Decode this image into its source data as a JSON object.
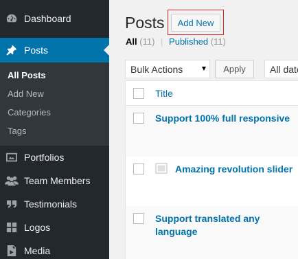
{
  "sidebar": {
    "items": [
      {
        "label": "Dashboard",
        "icon": "dashboard-icon"
      },
      {
        "label": "Posts",
        "icon": "pin-icon",
        "active": true
      },
      {
        "label": "Portfolios",
        "icon": "image-icon"
      },
      {
        "label": "Team Members",
        "icon": "people-icon"
      },
      {
        "label": "Testimonials",
        "icon": "quote-icon"
      },
      {
        "label": "Logos",
        "icon": "grid-icon"
      },
      {
        "label": "Media",
        "icon": "media-icon"
      }
    ],
    "submenu": [
      "All Posts",
      "Add New",
      "Categories",
      "Tags"
    ],
    "colors": {
      "background": "#23282d",
      "active": "#0073aa",
      "submenu_bg": "#32373c"
    }
  },
  "header": {
    "title": "Posts",
    "add_new_label": "Add New"
  },
  "views": {
    "all_label": "All",
    "all_count": "(11)",
    "separator": "|",
    "published_label": "Published",
    "published_count": "(11)"
  },
  "toolbar": {
    "bulk_actions_selected": "Bulk Actions",
    "apply_label": "Apply",
    "dates_selected": "All dates"
  },
  "table": {
    "column_title": "Title",
    "rows": [
      {
        "title": "Support 100% full responsive"
      },
      {
        "title": "Amazing revolution slider",
        "has_thumbnail_icon": true
      },
      {
        "title": "Support translated any language"
      }
    ]
  },
  "highlight_color": "#d9262d"
}
